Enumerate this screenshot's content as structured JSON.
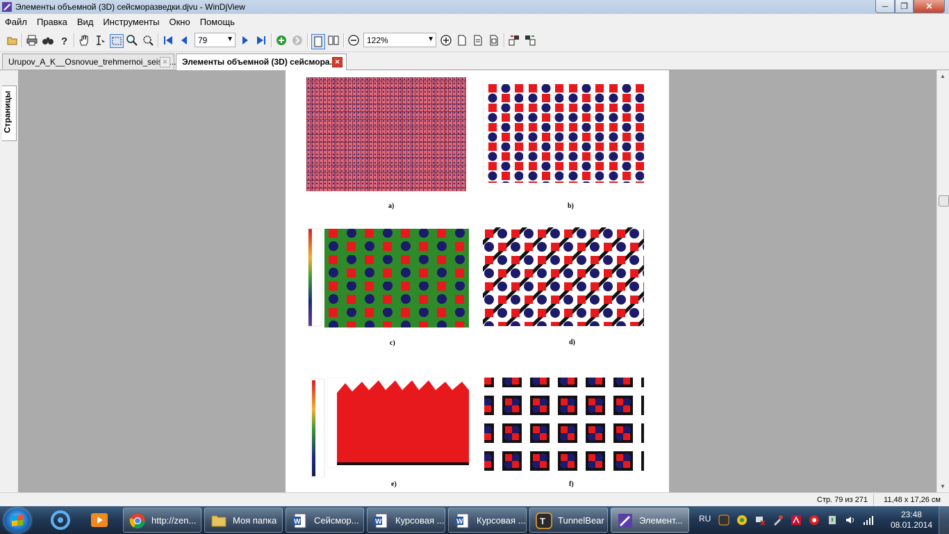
{
  "window": {
    "title": "Элементы объемной (3D) сейсморазведки.djvu - WinDjView",
    "minimize": "─",
    "maximize": "❐",
    "close": "✕"
  },
  "menu": [
    "Файл",
    "Правка",
    "Вид",
    "Инструменты",
    "Окно",
    "Помощь"
  ],
  "toolbar": {
    "page_number": "79",
    "zoom": "122%",
    "icons": [
      "open-icon",
      "print-icon",
      "find-icon",
      "help-icon",
      "hand-tool-icon",
      "text-select-icon",
      "rect-select-icon",
      "zoom-in-tool-icon",
      "zoom-rect-icon",
      "first-page-icon",
      "prev-page-icon",
      "next-page-icon",
      "last-page-icon",
      "back-icon",
      "forward-icon",
      "single-page-icon",
      "two-page-icon",
      "zoom-out-icon",
      "zoom-in-icon",
      "fit-page-icon",
      "fit-width-icon",
      "actual-size-icon",
      "rotate-left-icon",
      "rotate-right-icon"
    ]
  },
  "tabs": [
    {
      "label": "Urupov_A_K__Osnovue_trehmernoi_seism...",
      "active": false
    },
    {
      "label": "Элементы объемной (3D) сейсмора...",
      "active": true
    }
  ],
  "side_panel": {
    "tab_label": "Страницы"
  },
  "page": {
    "figures": [
      {
        "label": "a)"
      },
      {
        "label": "b)"
      },
      {
        "label": "c)"
      },
      {
        "label": "d)"
      },
      {
        "label": "e)"
      },
      {
        "label": "f)"
      }
    ],
    "colors": {
      "red": "#e8191c",
      "navy": "#1b1a6b",
      "green": "#2f8a2a",
      "black": "#111111"
    }
  },
  "status": {
    "page_info": "Стр. 79 из 271",
    "page_size": "11,48 x 17,26 см"
  },
  "taskbar": {
    "tasks": [
      {
        "label": "http://zen...",
        "icon": "chrome-icon"
      },
      {
        "label": "Моя папка",
        "icon": "folder-icon"
      },
      {
        "label": "Сейсмор...",
        "icon": "word-icon"
      },
      {
        "label": "Курсовая ...",
        "icon": "word-icon"
      },
      {
        "label": "Курсовая ...",
        "icon": "word-icon"
      },
      {
        "label": "TunnelBear",
        "icon": "tunnelbear-icon"
      },
      {
        "label": "Элемент...",
        "icon": "windjview-icon"
      }
    ],
    "language": "RU",
    "time": "23:48",
    "date": "08.01.2014"
  }
}
